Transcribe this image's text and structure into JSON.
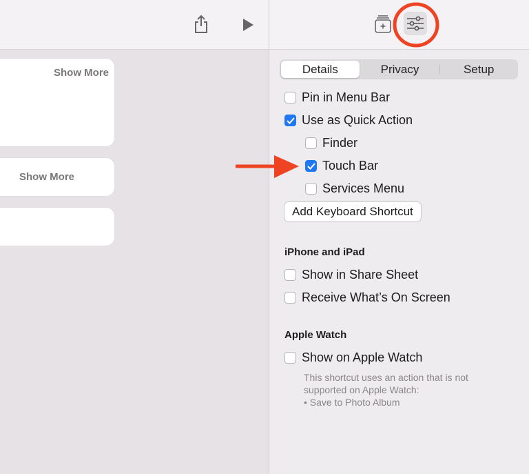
{
  "left": {
    "cards": [
      {
        "show_more": "Show More"
      },
      {
        "show_more": "Show More"
      },
      {
        "show_more": ""
      }
    ],
    "toolbar_icons": [
      "share-icon",
      "play-icon"
    ]
  },
  "right": {
    "toolbar_icons": [
      "add-to-library-icon",
      "settings-sliders-icon"
    ],
    "tabs": [
      {
        "label": "Details",
        "active": true
      },
      {
        "label": "Privacy",
        "active": false
      },
      {
        "label": "Setup",
        "active": false
      }
    ],
    "options": {
      "pin_menu_bar": {
        "label": "Pin in Menu Bar",
        "checked": false
      },
      "quick_action": {
        "label": "Use as Quick Action",
        "checked": true
      },
      "finder": {
        "label": "Finder",
        "checked": false
      },
      "touch_bar": {
        "label": "Touch Bar",
        "checked": true
      },
      "services_menu": {
        "label": "Services Menu",
        "checked": false
      }
    },
    "add_shortcut_label": "Add Keyboard Shortcut",
    "iphone_section": {
      "title": "iPhone and iPad",
      "share_sheet": {
        "label": "Show in Share Sheet",
        "checked": false
      },
      "whats_on_screen": {
        "label": "Receive What’s On Screen",
        "checked": false
      }
    },
    "watch_section": {
      "title": "Apple Watch",
      "show_on_watch": {
        "label": "Show on Apple Watch",
        "checked": false
      },
      "note_lines": [
        "This shortcut uses an action that is not",
        "supported on Apple Watch:",
        "• Save to Photo Album"
      ]
    }
  },
  "colors": {
    "accent": "#1f78f2",
    "annotation": "#ef4424"
  }
}
